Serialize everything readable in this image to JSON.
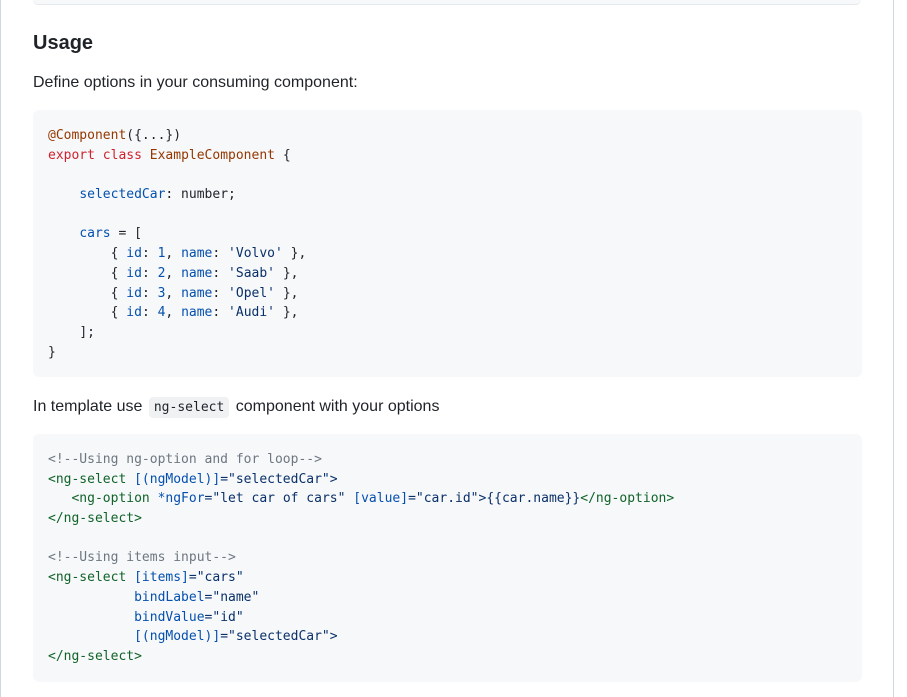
{
  "section": {
    "heading": "Usage",
    "intro": "Define options in your consuming component:",
    "template_text_before": "In template use",
    "template_inline_code": "ng-select",
    "template_text_after": "component with your options"
  },
  "code_component": {
    "l1_decorator": "@Component",
    "l1_rest": "({...})",
    "l2_export": "export",
    "l2_class": "class",
    "l2_name": "ExampleComponent",
    "l2_brace": " {",
    "l4_prop": "selectedCar",
    "l4_rest": ": number;",
    "l6_prop": "cars",
    "l6_rest": " = [",
    "rows": [
      {
        "id": "1",
        "name": "'Volvo'"
      },
      {
        "id": "2",
        "name": "'Saab'"
      },
      {
        "id": "3",
        "name": "'Opel'"
      },
      {
        "id": "4",
        "name": "'Audi'"
      }
    ],
    "row_open": "{ ",
    "row_id_key": "id",
    "row_name_key": "name",
    "row_close": " },",
    "l11": "];",
    "l12": "}"
  },
  "code_template": {
    "c1": "<!--Using ng-option and for loop-->",
    "t1_open": "<ng-select ",
    "t1_attr": "[(ngModel)]",
    "t1_val": "=\"selectedCar\">",
    "t2_open": "<ng-option ",
    "t2_attr1": "*ngFor",
    "t2_val1": "=\"let car of cars\" ",
    "t2_attr2": "[value]",
    "t2_val2": "=\"car.id\">{{car.name}}",
    "t2_close": "</ng-option>",
    "t3_close": "</ng-select>",
    "c2": "<!--Using items input-->",
    "t5_open": "<ng-select ",
    "t5_attr": "[items]",
    "t5_val": "=\"cars\"",
    "t6_attr": "bindLabel",
    "t6_val": "=\"name\"",
    "t7_attr": "bindValue",
    "t7_val": "=\"id\"",
    "t8_attr": "[(ngModel)]",
    "t8_val": "=\"selectedCar\">",
    "t9_close": "</ng-select>"
  }
}
